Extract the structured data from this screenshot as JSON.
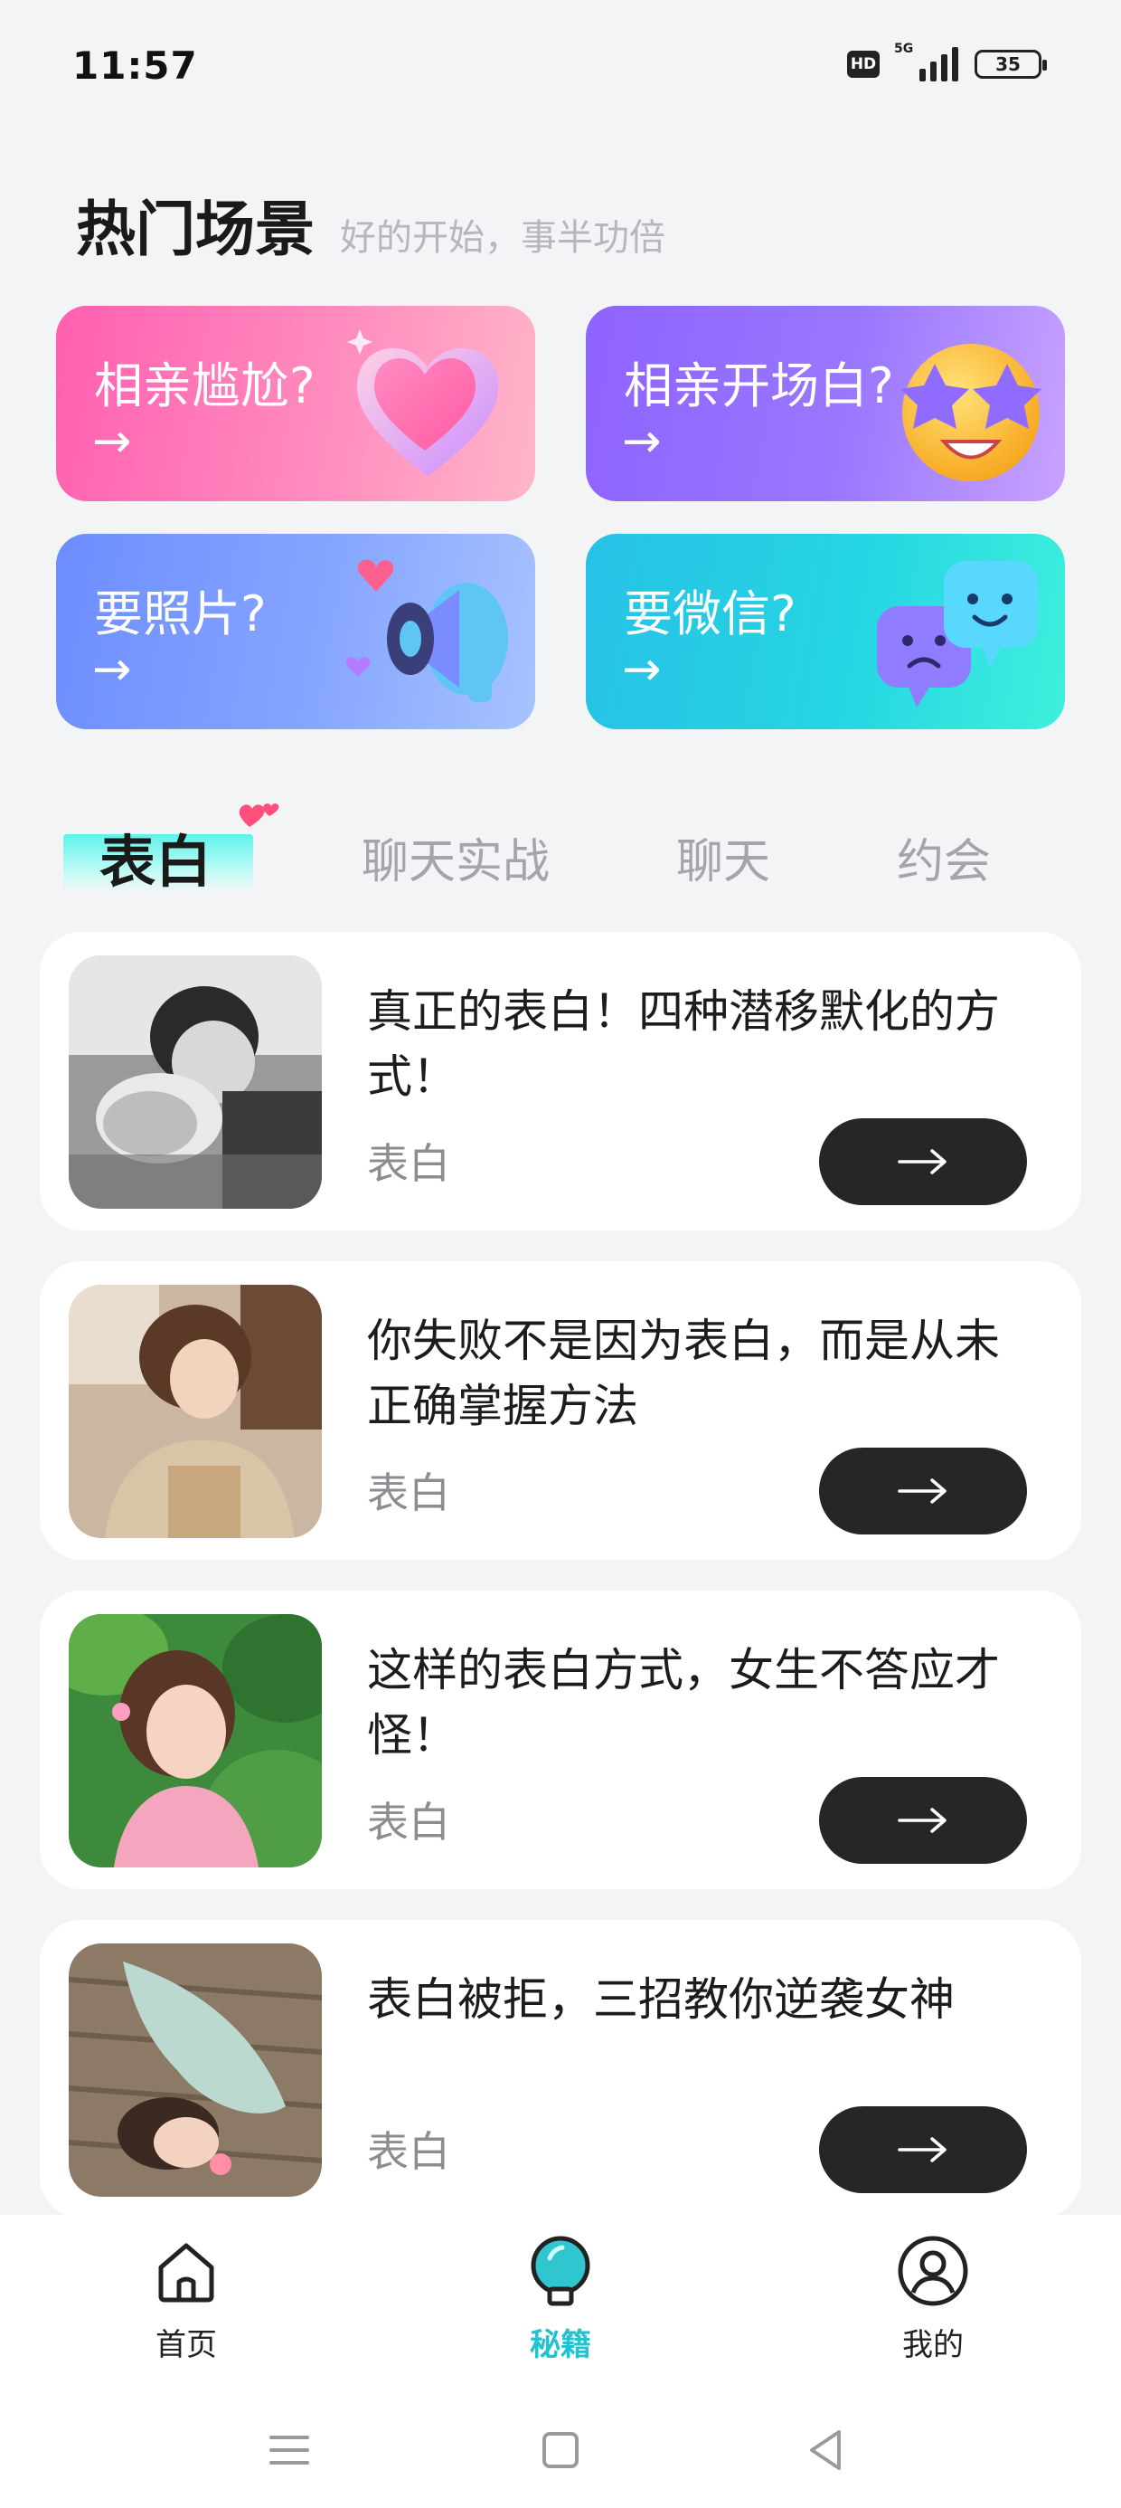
{
  "status_bar": {
    "time": "11:57",
    "network": "5G",
    "hd": "HD",
    "battery": "35"
  },
  "header": {
    "title": "热门场景",
    "subtitle": "好的开始，事半功倍"
  },
  "scenes": [
    {
      "label": "相亲尴尬?",
      "arrow": "→",
      "icon": "heart-3d-icon"
    },
    {
      "label": "相亲开场白?",
      "arrow": "→",
      "icon": "star-eyes-emoji-icon"
    },
    {
      "label": "要照片?",
      "arrow": "→",
      "icon": "megaphone-hearts-icon"
    },
    {
      "label": "要微信?",
      "arrow": "→",
      "icon": "chat-bubbles-icon"
    }
  ],
  "tabs": [
    {
      "label": "表白",
      "active": true
    },
    {
      "label": "聊天实战",
      "active": false
    },
    {
      "label": "聊天",
      "active": false
    },
    {
      "label": "约会",
      "active": false
    }
  ],
  "articles": [
    {
      "title": "真正的表白！四种潜移默化的方式！",
      "tag": "表白"
    },
    {
      "title": "你失败不是因为表白，而是从未正确掌握方法",
      "tag": "表白"
    },
    {
      "title": "这样的表白方式，女生不答应才怪！",
      "tag": "表白"
    },
    {
      "title": "表白被拒，三招教你逆袭女神",
      "tag": "表白"
    }
  ],
  "nav": [
    {
      "label": "首页",
      "icon": "home-icon",
      "active": false
    },
    {
      "label": "秘籍",
      "icon": "lightbulb-icon",
      "active": true
    },
    {
      "label": "我的",
      "icon": "user-icon",
      "active": false
    }
  ],
  "colors": {
    "accent": "#23c2cf",
    "button_dark": "#262626",
    "background": "#f3f4f6"
  }
}
